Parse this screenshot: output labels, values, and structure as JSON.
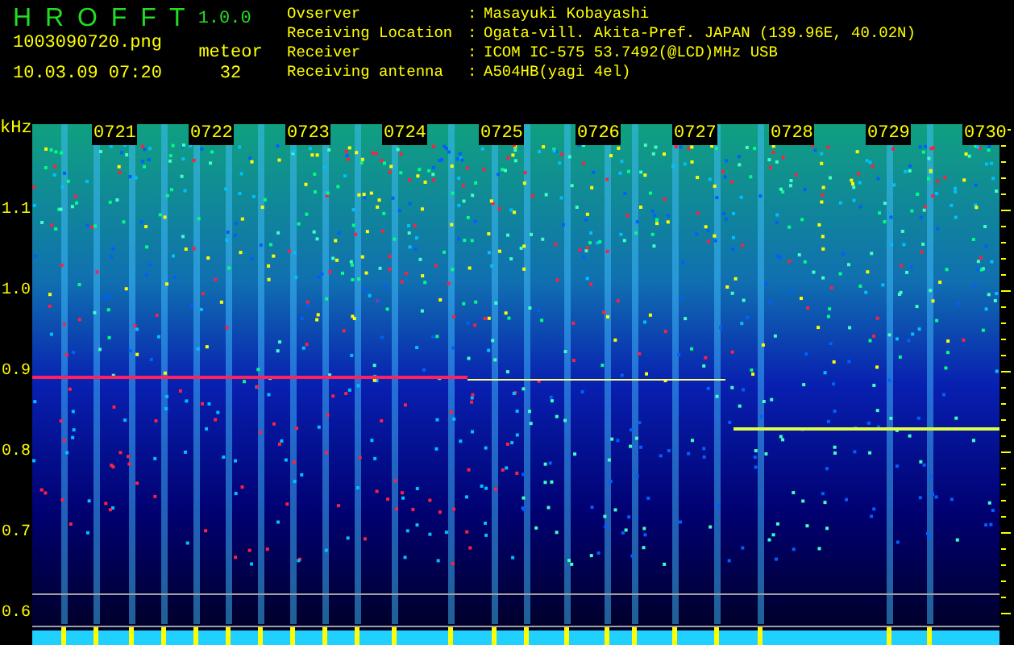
{
  "app": {
    "title": "H R O F F T",
    "version": "1.0.0",
    "file": "1003090720.png",
    "datetime": "10.03.09 07:20",
    "count_label": "meteor",
    "count": "32"
  },
  "info": [
    {
      "label": "Ovserver",
      "sep": ":",
      "value": "Masayuki Kobayashi"
    },
    {
      "label": "Receiving Location",
      "sep": ":",
      "value": "Ogata-vill. Akita-Pref. JAPAN (139.96E, 40.02N)"
    },
    {
      "label": "Receiver",
      "sep": ":",
      "value": "ICOM IC-575 53.7492(@LCD)MHz USB"
    },
    {
      "label": "Receiving antenna",
      "sep": ":",
      "value": "A504HB(yagi 4el)"
    }
  ],
  "axis": {
    "unit": "kHz",
    "ticks": [
      "1.1",
      "1.0",
      "0.9",
      "0.8",
      "0.7",
      "0.6"
    ],
    "times": [
      "0721",
      "0722",
      "0723",
      "0724",
      "0725",
      "0726",
      "0727",
      "0728",
      "0729",
      "0730"
    ]
  }
}
